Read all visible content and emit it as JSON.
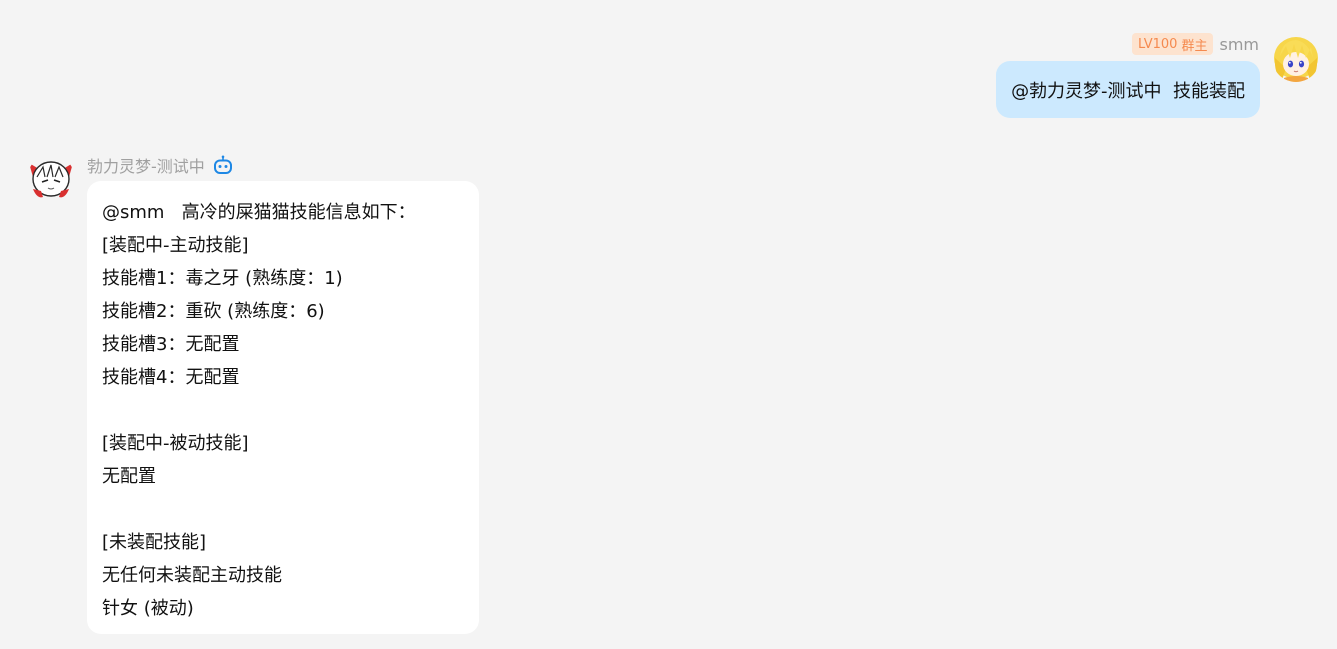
{
  "outgoing": {
    "badge": {
      "level": "LV100",
      "role": "群主",
      "bg_color": "#fde3cf",
      "text_color": "#f58a4f"
    },
    "sender": "smm",
    "text": "@勃力灵梦-测试中  技能装配",
    "bubble_color": "#cce9fe",
    "avatar_icon": "blonde-anime-girl-avatar"
  },
  "incoming": {
    "sender": "勃力灵梦-测试中",
    "bot_icon": "robot-icon",
    "bot_icon_color": "#1e88e5",
    "avatar_icon": "reimu-chibi-avatar",
    "lines": [
      "@smm   高冷的屎猫猫技能信息如下：",
      "[装配中-主动技能]",
      "技能槽1：毒之牙 (熟练度：1)",
      "技能槽2：重砍 (熟练度：6)",
      "技能槽3：无配置",
      "技能槽4：无配置",
      "",
      "[装配中-被动技能]",
      "无配置",
      "",
      "[未装配技能]",
      "无任何未装配主动技能",
      "针女 (被动)"
    ]
  }
}
